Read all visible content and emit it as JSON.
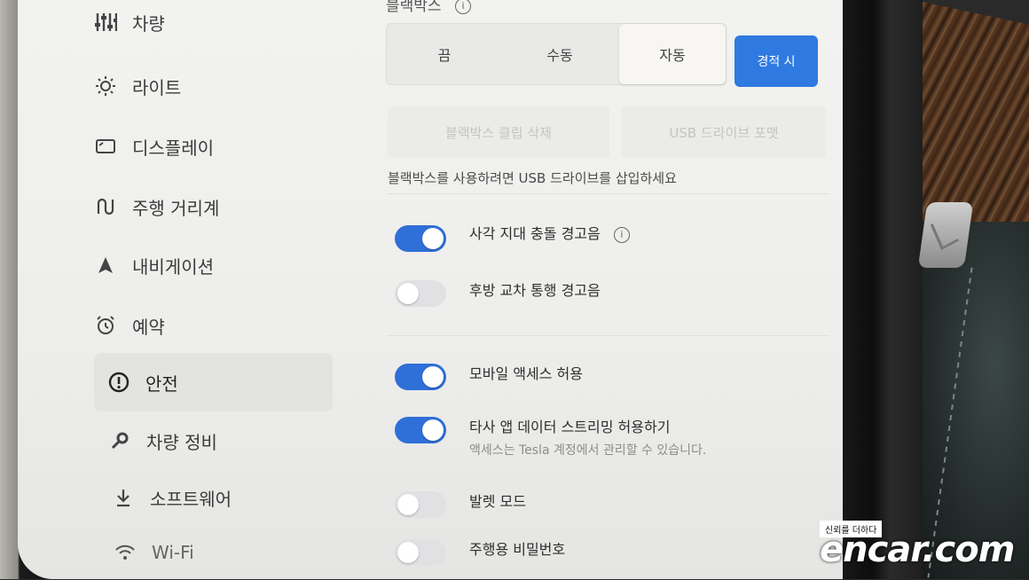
{
  "sidebar": {
    "items": [
      {
        "label": "차량",
        "icon": "sliders-icon"
      },
      {
        "label": "라이트",
        "icon": "sun-icon"
      },
      {
        "label": "디스플레이",
        "icon": "display-icon"
      },
      {
        "label": "주행 거리계",
        "icon": "route-icon"
      },
      {
        "label": "내비게이션",
        "icon": "navigation-arrow-icon"
      },
      {
        "label": "예약",
        "icon": "alarm-clock-icon"
      },
      {
        "label": "안전",
        "icon": "alert-circle-icon",
        "active": true
      },
      {
        "label": "차량 정비",
        "icon": "wrench-icon"
      },
      {
        "label": "소프트웨어",
        "icon": "download-icon"
      },
      {
        "label": "Wi-Fi",
        "icon": "wifi-icon"
      }
    ]
  },
  "dashcam": {
    "title": "블랙박스",
    "options": [
      "끔",
      "수동",
      "자동",
      "경적 시"
    ],
    "selected": "자동",
    "accent_color": "#2f7ae1",
    "delete_clips_label": "블랙박스 클립 삭제",
    "format_usb_label": "USB 드라이브 포맷",
    "note": "블랙박스를 사용하려면 USB 드라이브를 삽입하세요"
  },
  "toggles": [
    {
      "label": "사각 지대 충돌 경고음",
      "on": true,
      "info": true
    },
    {
      "label": "후방 교차 통행 경고음",
      "on": false
    },
    {
      "label": "모바일 액세스 허용",
      "on": true
    },
    {
      "label": "타사 앱 데이터 스트리밍 허용하기",
      "on": true,
      "sub": "액세스는 Tesla 계정에서 관리할 수 있습니다."
    },
    {
      "label": "발렛 모드",
      "on": false
    },
    {
      "label": "주행용 비밀번호",
      "on": false
    }
  ],
  "watermark": {
    "tagline": "신뢰를 더하다",
    "logo": "encar.com"
  }
}
